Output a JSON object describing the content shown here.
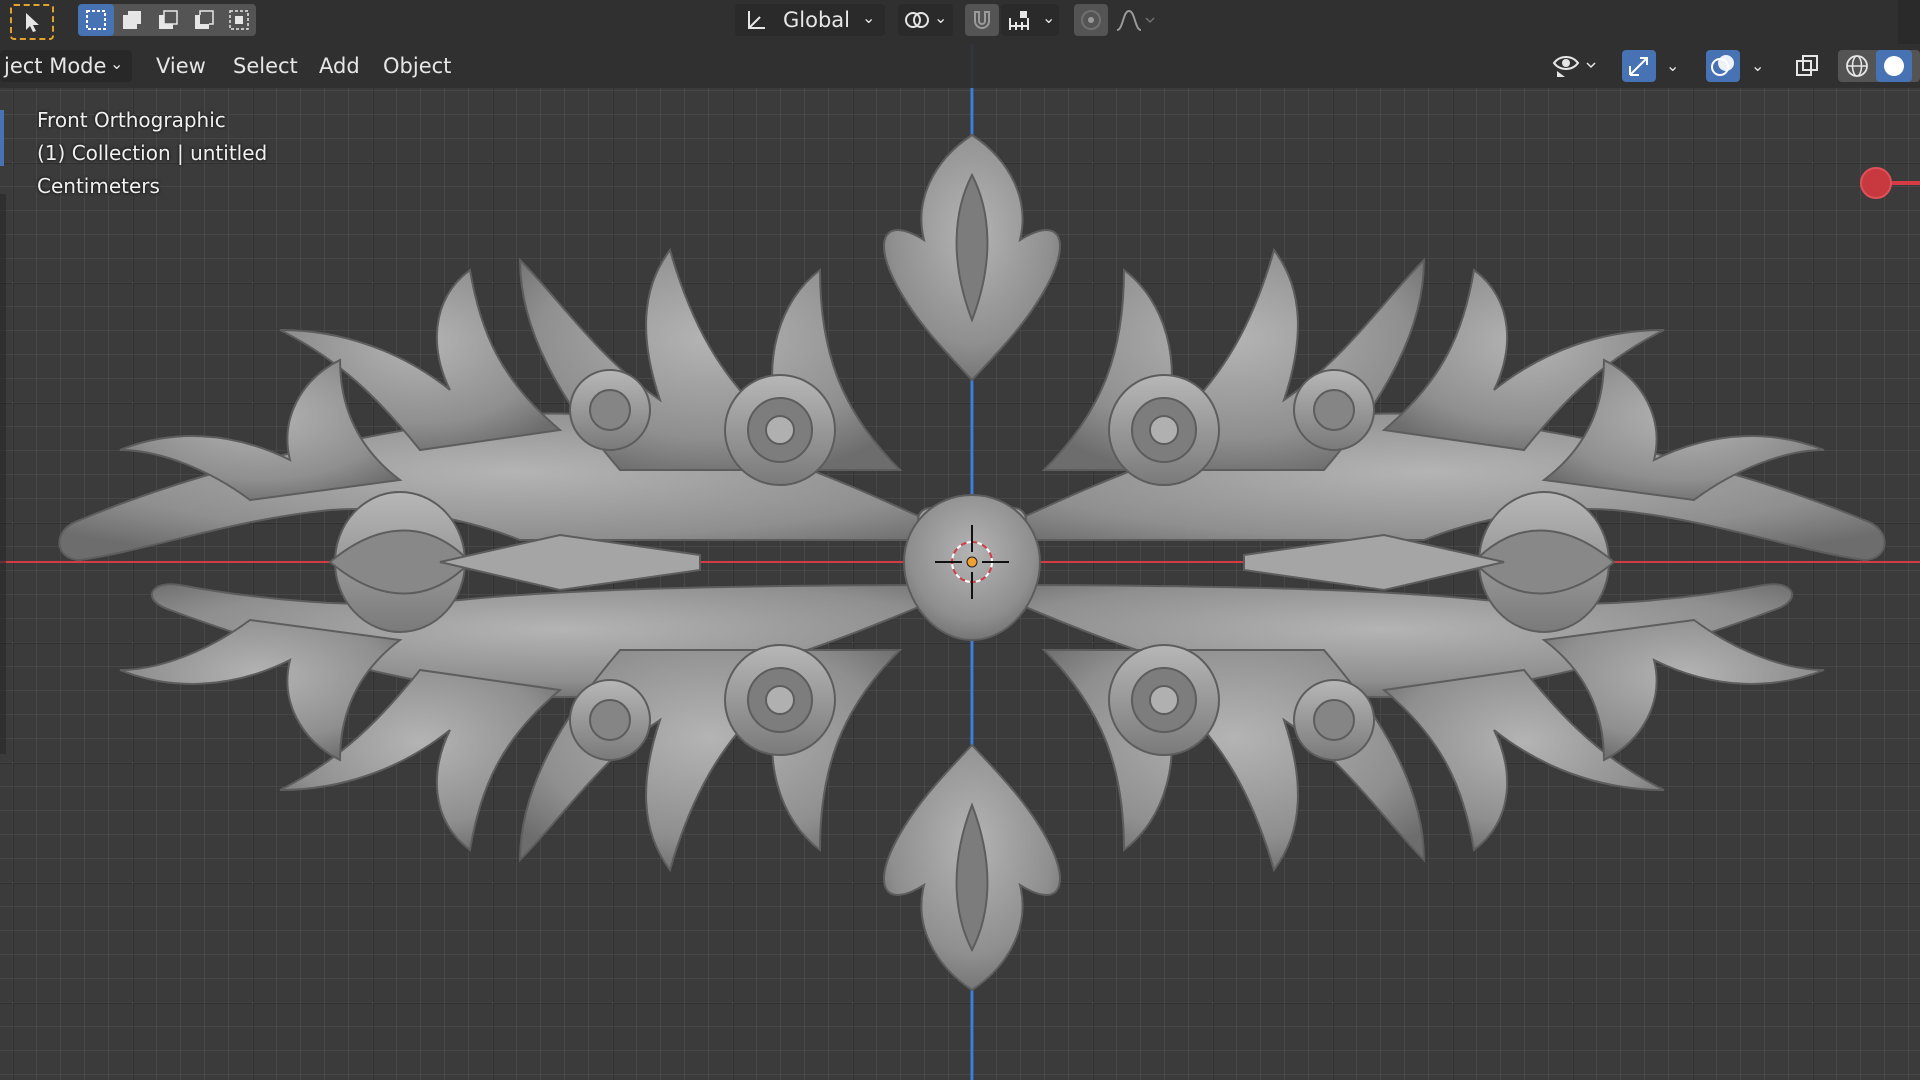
{
  "header": {
    "transform_orientation": "Global",
    "mode": "ject Mode",
    "menus": [
      "View",
      "Select",
      "Add",
      "Object"
    ]
  },
  "viewport": {
    "view_name": "Front Orthographic",
    "collection": "(1) Collection | untitled",
    "units": "Centimeters"
  },
  "icons": {
    "select_tool": "cursor-arrow-icon",
    "box_select_modes": [
      "box-new-icon",
      "box-extend-icon",
      "box-subtract-icon",
      "box-invert-icon",
      "box-intersect-icon"
    ],
    "orientation": "transform-orientation-icon",
    "pivot": "pivot-point-icon",
    "snap": "snap-magnet-icon",
    "snap_increment": "snap-increment-icon",
    "proportional": "proportional-edit-icon",
    "falloff": "falloff-curve-icon",
    "visibility": "object-visibility-icon",
    "gizmo": "gizmo-toggle-icon",
    "overlays": "overlays-icon",
    "xray": "xray-toggle-icon",
    "shading": [
      "wireframe-shading-icon",
      "solid-shading-icon"
    ]
  },
  "colors": {
    "header_bg": "#303030",
    "viewport_bg": "#3b3b3b",
    "axis_x": "#d43b45",
    "axis_z": "#3d7fd9",
    "active_tool": "#e3a32b",
    "selected_icon_bg": "#4772b3",
    "model": "#9a9a9a"
  }
}
